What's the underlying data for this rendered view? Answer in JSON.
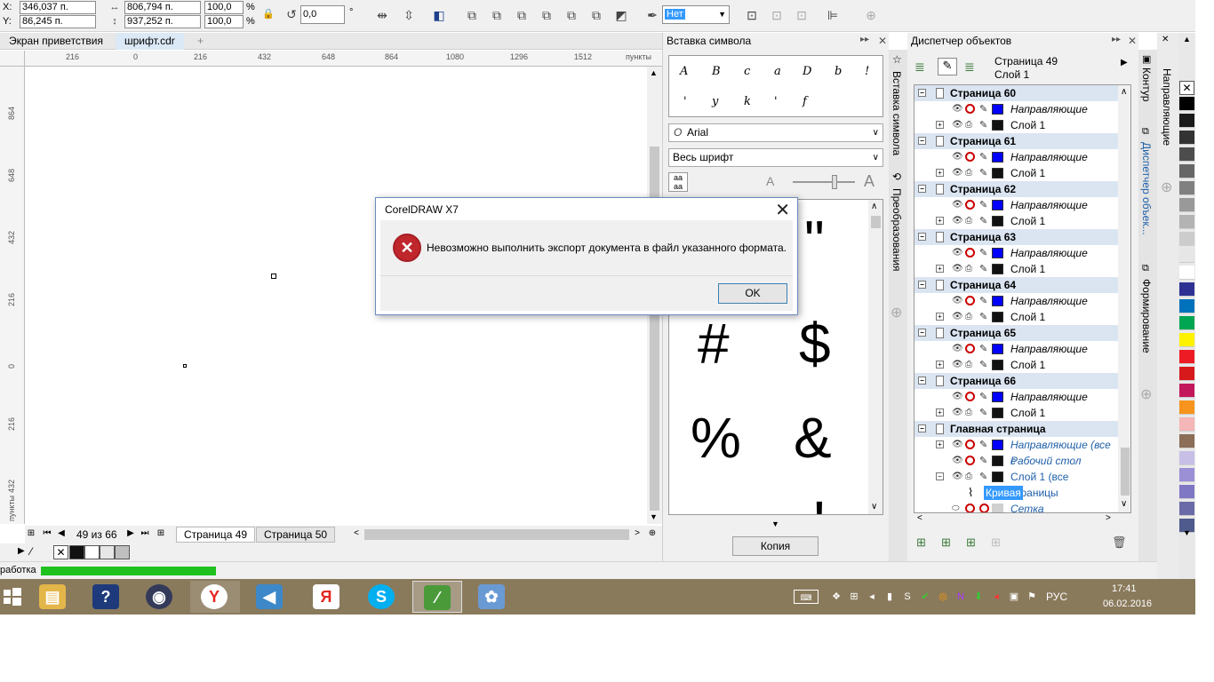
{
  "propbar": {
    "x_label": "X:",
    "x_value": "346,037 п.",
    "y_label": "Y:",
    "y_value": "86,245 п.",
    "w_value": "806,794 п.",
    "h_value": "937,252 п.",
    "scale_x": "100,0",
    "scale_y": "100,0",
    "pct": "%",
    "angle": "0,0",
    "deg": "°",
    "outline_select": "Нет"
  },
  "tabs": [
    {
      "label": "Экран приветствия"
    },
    {
      "label": "шрифт.cdr"
    }
  ],
  "hruler": {
    "ticks": [
      "216",
      "0",
      "216",
      "432",
      "648",
      "864",
      "1080",
      "1296",
      "1512"
    ],
    "unit": "пункты"
  },
  "vruler": {
    "ticks": [
      "864",
      "648",
      "432",
      "216",
      "0",
      "216",
      "432"
    ],
    "unit": "пункты"
  },
  "pagenav": {
    "counter": "49 из 66",
    "tabs": [
      "Страница 49",
      "Страница 50"
    ]
  },
  "status": {
    "text": "работка"
  },
  "symbols": {
    "title": "Вставка символа",
    "font": "Arial",
    "subset": "Весь шрифт",
    "preview_glyphs": [
      "A",
      "B",
      "c",
      "a",
      "D",
      "b",
      "!",
      "'",
      "y",
      "k",
      "'",
      "f"
    ],
    "chars": [
      "\"",
      "#",
      "$",
      "%",
      "&",
      "'",
      "!"
    ],
    "copy_label": "Копия",
    "side_tabs": [
      "Вставка символа",
      "Преобразования"
    ]
  },
  "objects": {
    "title": "Диспетчер объектов",
    "current_page": "Страница 49",
    "current_layer": "Слой 1",
    "rows": [
      {
        "kind": "page",
        "label": "Страница 60"
      },
      {
        "kind": "guides",
        "label": "Направляющие"
      },
      {
        "kind": "layer",
        "label": "Слой 1"
      },
      {
        "kind": "page",
        "label": "Страница 61"
      },
      {
        "kind": "guides",
        "label": "Направляющие"
      },
      {
        "kind": "layer",
        "label": "Слой 1"
      },
      {
        "kind": "page",
        "label": "Страница 62"
      },
      {
        "kind": "guides",
        "label": "Направляющие"
      },
      {
        "kind": "layer",
        "label": "Слой 1"
      },
      {
        "kind": "page",
        "label": "Страница 63"
      },
      {
        "kind": "guides",
        "label": "Направляющие"
      },
      {
        "kind": "layer",
        "label": "Слой 1"
      },
      {
        "kind": "page",
        "label": "Страница 64"
      },
      {
        "kind": "guides",
        "label": "Направляющие"
      },
      {
        "kind": "layer",
        "label": "Слой 1"
      },
      {
        "kind": "page",
        "label": "Страница 65"
      },
      {
        "kind": "guides",
        "label": "Направляющие"
      },
      {
        "kind": "layer",
        "label": "Слой 1"
      },
      {
        "kind": "page",
        "label": "Страница 66"
      },
      {
        "kind": "guides",
        "label": "Направляющие"
      },
      {
        "kind": "layer",
        "label": "Слой 1"
      },
      {
        "kind": "page",
        "label": "Главная страница"
      },
      {
        "kind": "guides-master",
        "label": "Направляющие (все с"
      },
      {
        "kind": "desktop",
        "label": "Рабочий стол"
      },
      {
        "kind": "layer-master",
        "label": "Слой 1 (все страницы"
      },
      {
        "kind": "curve",
        "label": "Кривая"
      },
      {
        "kind": "grid",
        "label": "Сетка"
      }
    ],
    "side_tabs": [
      "Контур",
      "Диспетчер объек...",
      "Формирование"
    ],
    "far_tab": "Направляющие"
  },
  "dialog": {
    "title": "CorelDRAW X7",
    "message": "Невозможно выполнить экспорт документа в файл указанного формата.",
    "ok_label": "OK"
  },
  "taskbar": {
    "lang": "РУС",
    "time": "17:41",
    "date": "06.02.2016"
  },
  "colors": {
    "accent_green": "#1fc11f",
    "guide_blue": "#0000ff",
    "error_red": "#c0272d",
    "palette": [
      "#000000",
      "#1a1a1a",
      "#333333",
      "#4d4d4d",
      "#666666",
      "#808080",
      "#999999",
      "#b3b3b3",
      "#cccccc",
      "#e6e6e6",
      "#ffffff",
      "#2e3192",
      "#0072bc",
      "#00a651",
      "#fff200",
      "#ed1c24",
      "#d7191c",
      "#c2185b",
      "#f7941d",
      "#f4b6b6",
      "#8c6d58",
      "#c8bfe7",
      "#9b8fd6",
      "#7f77c4",
      "#6a6aa8",
      "#4f5b8c"
    ]
  }
}
